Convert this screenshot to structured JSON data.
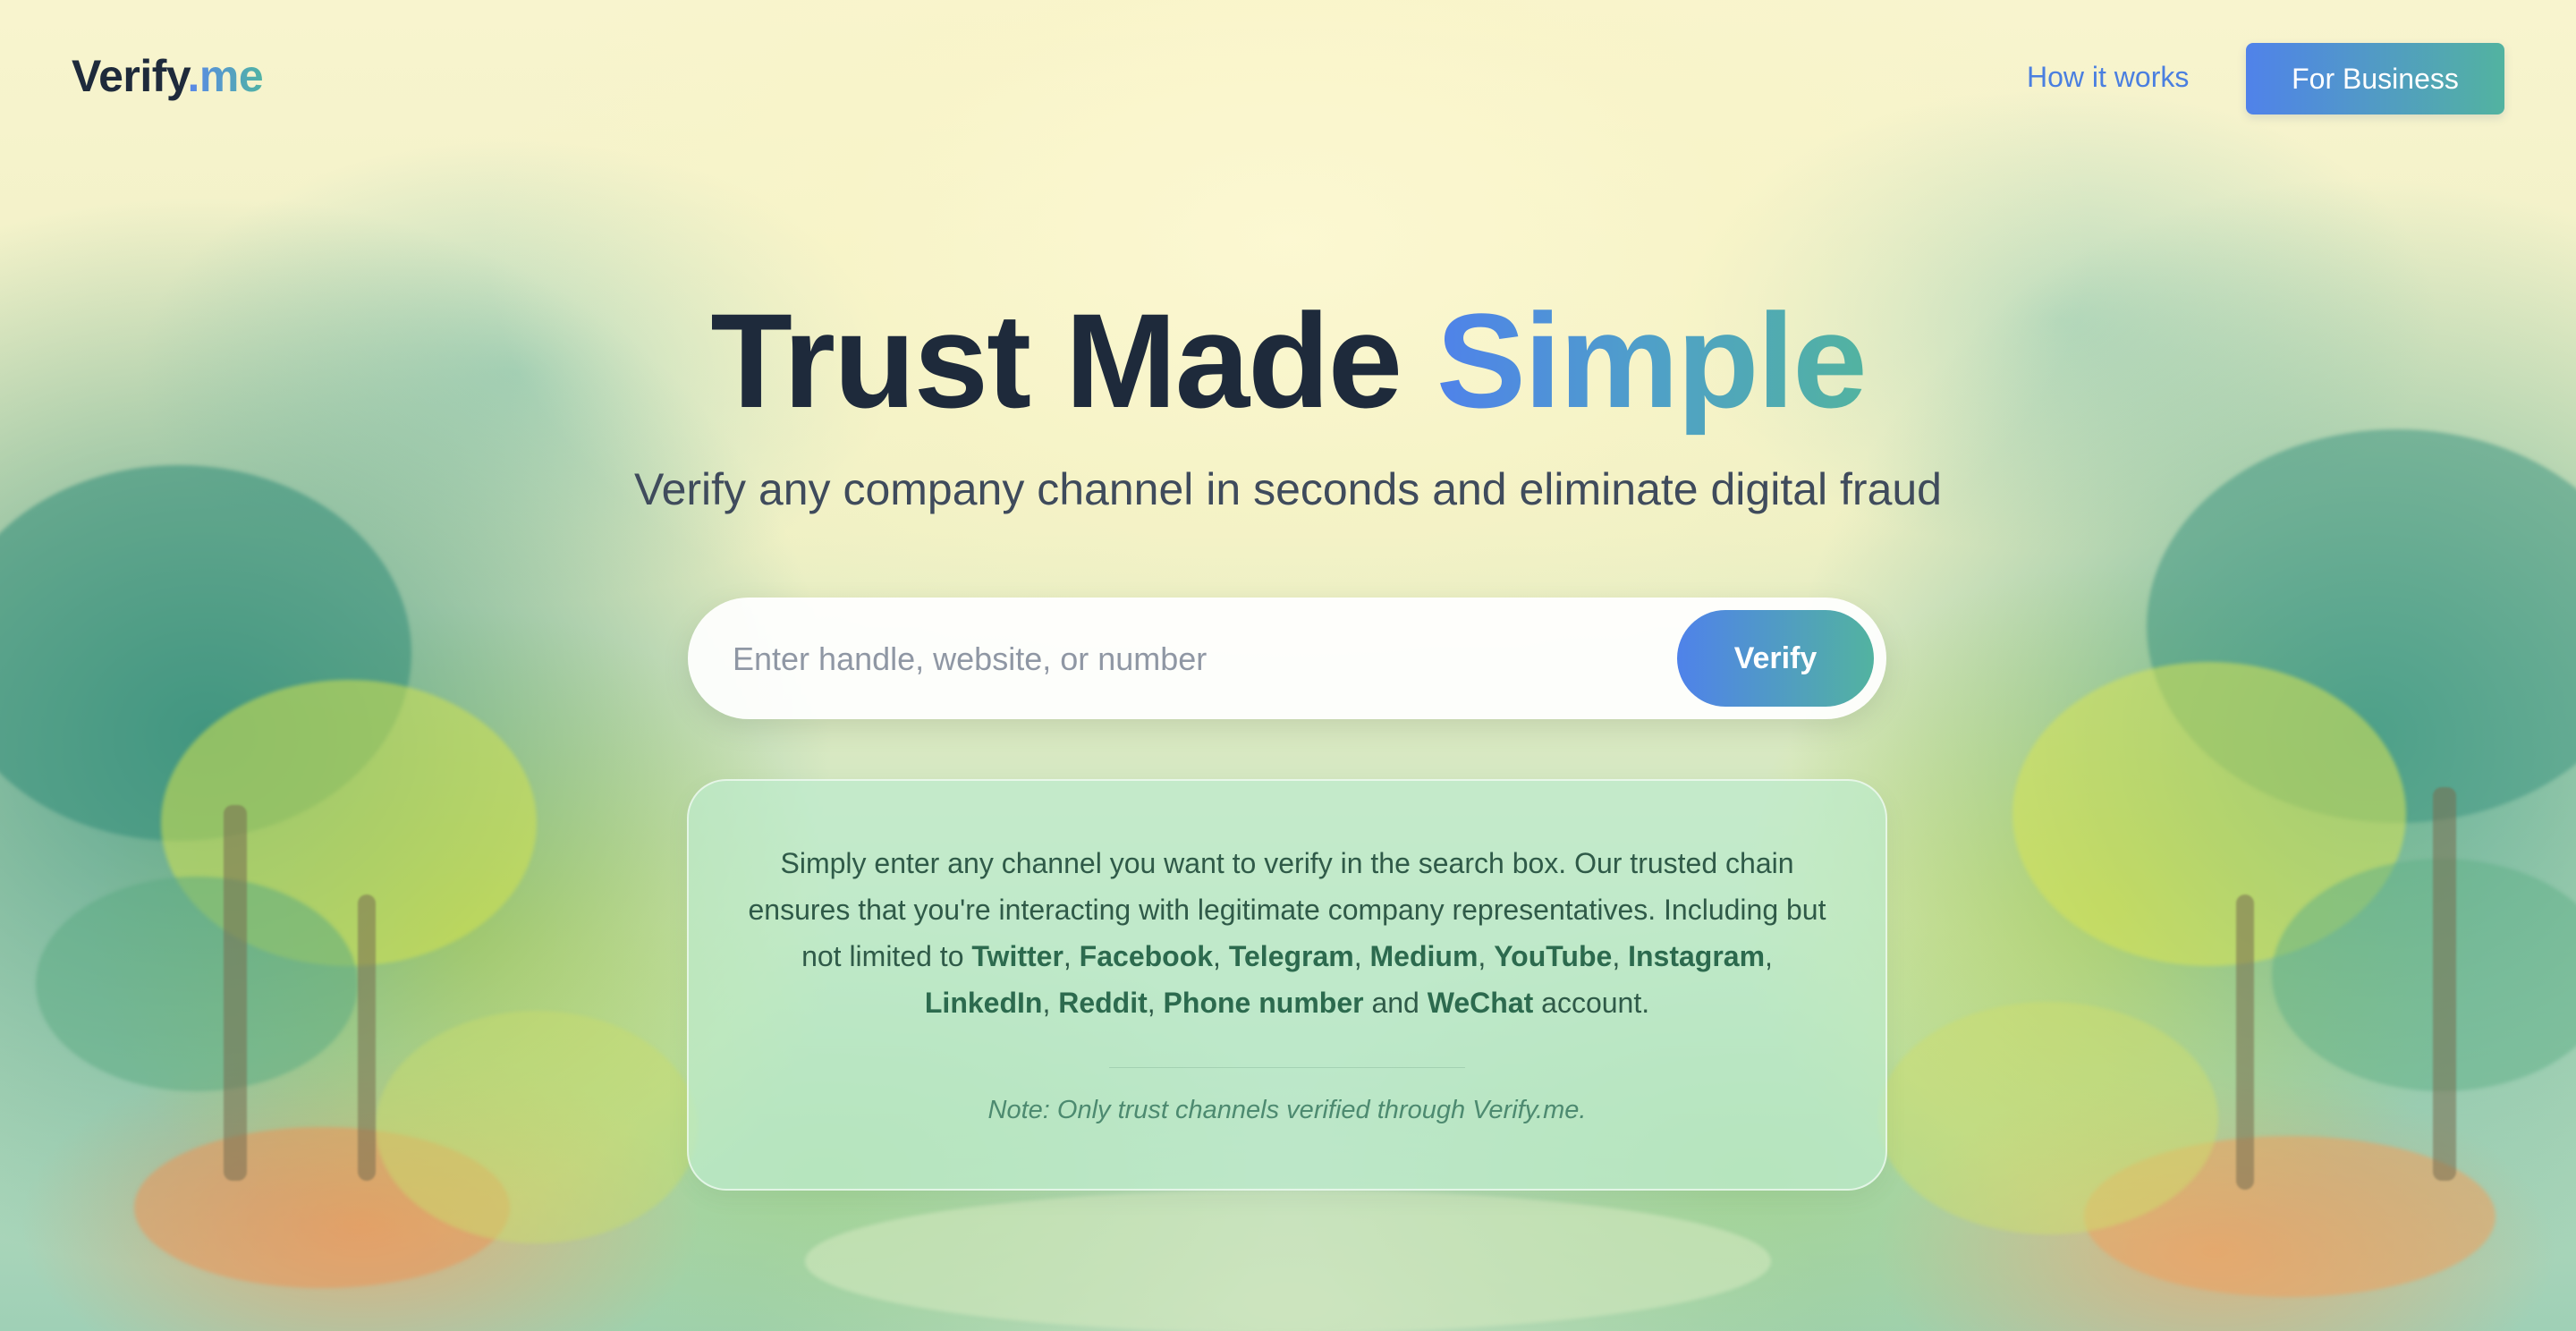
{
  "header": {
    "logo_main": "Verify",
    "logo_tld": ".me",
    "nav_how_it_works": "How it works",
    "business_button": "For Business"
  },
  "hero": {
    "title_main": "Trust Made ",
    "title_accent": "Simple",
    "subtitle": "Verify any company channel in seconds and eliminate digital fraud"
  },
  "search": {
    "placeholder": "Enter handle, website, or number",
    "value": "",
    "button_label": "Verify"
  },
  "info_card": {
    "intro": "Simply enter any channel you want to verify in the search box. Our trusted chain ensures that you're interacting with legitimate company representatives. Including but not limited to ",
    "channels": [
      "Twitter",
      "Facebook",
      "Telegram",
      "Medium",
      "YouTube",
      "Instagram",
      "LinkedIn",
      "Reddit",
      "Phone number"
    ],
    "and_word": " and ",
    "last_channel": "WeChat",
    "suffix": " account.",
    "note": "Note: Only trust channels verified through Verify.me."
  },
  "colors": {
    "brand_blue": "#4f82ea",
    "brand_teal": "#52b3a0",
    "title_dark": "#1e2a3b",
    "card_green": "#2f5a48"
  }
}
